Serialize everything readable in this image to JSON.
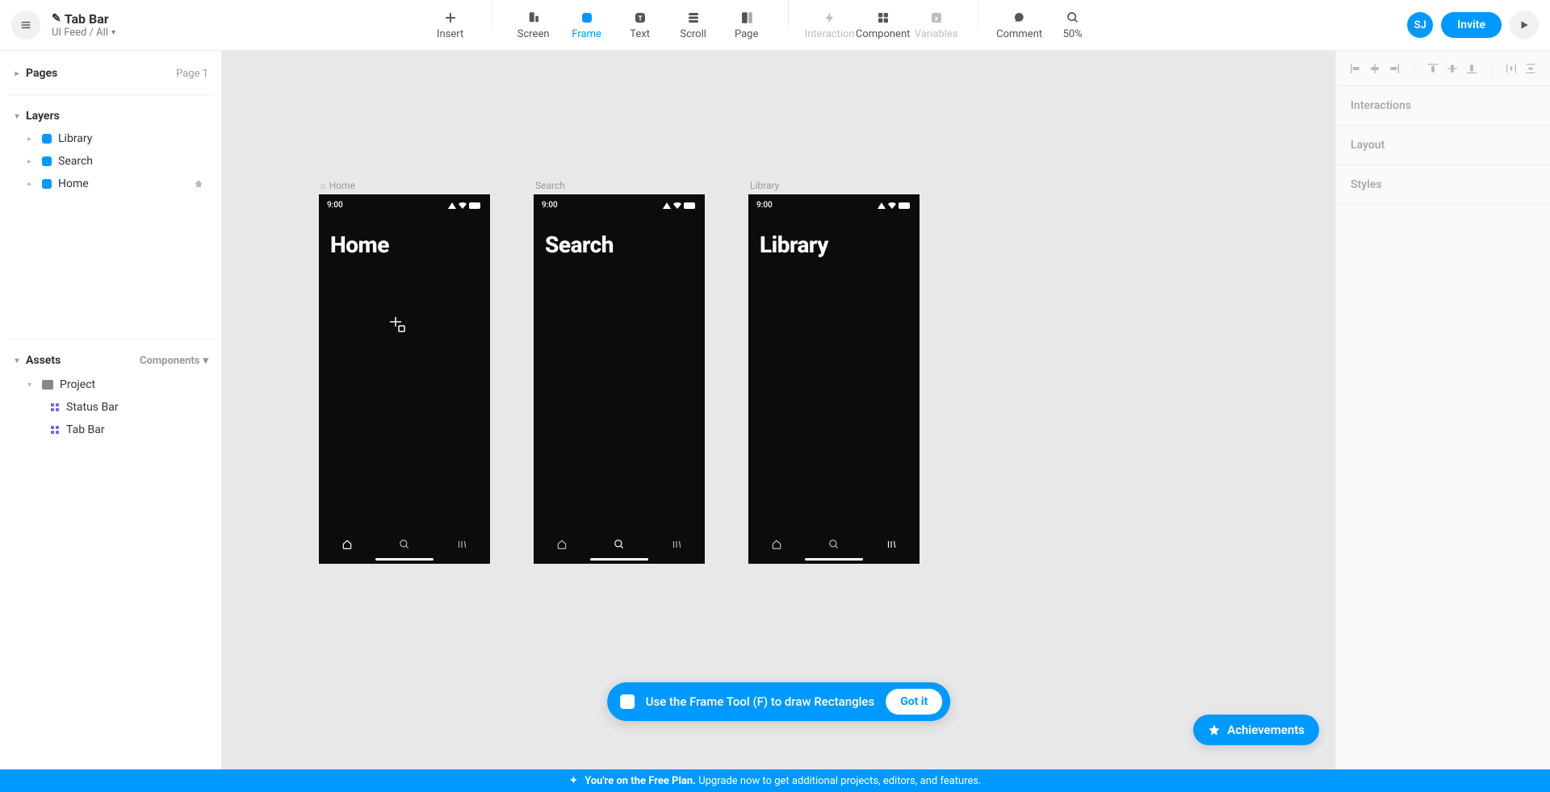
{
  "header": {
    "title": "Tab Bar",
    "breadcrumb": "UI Feed / All"
  },
  "toolbar": {
    "insert": "Insert",
    "screen": "Screen",
    "frame": "Frame",
    "text": "Text",
    "scroll": "Scroll",
    "page": "Page",
    "interaction": "Interaction",
    "component": "Component",
    "variables": "Variables",
    "comment": "Comment",
    "zoom": "50%"
  },
  "user": {
    "initials": "SJ",
    "invite": "Invite"
  },
  "leftPanel": {
    "pages": {
      "label": "Pages",
      "meta": "Page 1"
    },
    "layers": {
      "label": "Layers",
      "items": [
        "Library",
        "Search",
        "Home"
      ]
    },
    "assets": {
      "label": "Assets",
      "filter": "Components",
      "project": "Project",
      "components": [
        "Status Bar",
        "Tab Bar"
      ]
    }
  },
  "canvas": {
    "artboards": [
      {
        "label": "Home",
        "title": "Home",
        "showHouse": true,
        "activeTab": 0
      },
      {
        "label": "Search",
        "title": "Search",
        "showHouse": false,
        "activeTab": 1
      },
      {
        "label": "Library",
        "title": "Library",
        "showHouse": false,
        "activeTab": 2
      }
    ],
    "time": "9:00"
  },
  "hint": {
    "text": "Use the Frame Tool (F) to draw Rectangles",
    "button": "Got it"
  },
  "achievements": "Achievements",
  "rightPanel": {
    "interactions": "Interactions",
    "layout": "Layout",
    "styles": "Styles"
  },
  "banner": {
    "bold": "You're on the Free Plan.",
    "rest": "Upgrade now to get additional projects, editors, and features."
  }
}
